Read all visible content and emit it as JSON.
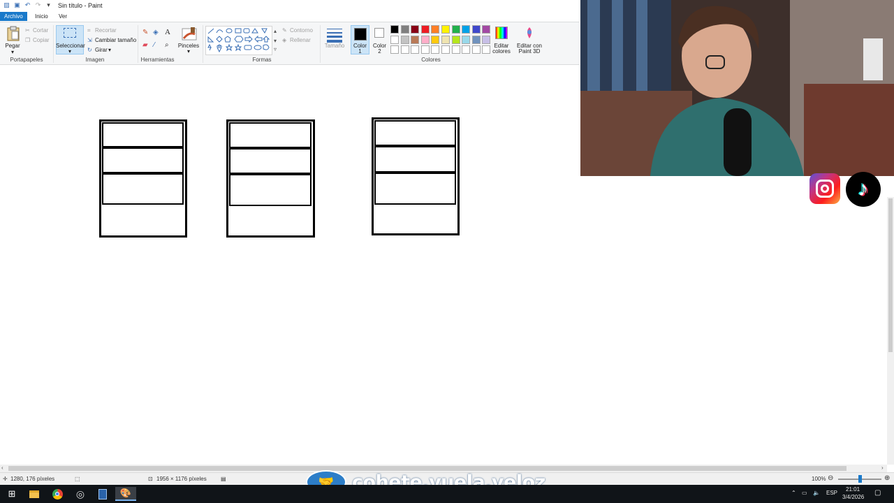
{
  "titlebar": {
    "title": "Sin título - Paint"
  },
  "menu": {
    "file": "Archivo",
    "home": "Inicio",
    "view": "Ver"
  },
  "ribbon": {
    "clipboard": {
      "paste": "Pegar",
      "cut": "Cortar",
      "copy": "Copiar",
      "group": "Portapapeles"
    },
    "image": {
      "select": "Seleccionar",
      "crop": "Recortar",
      "resize": "Cambiar tamaño",
      "rotate": "Girar",
      "group": "Imagen"
    },
    "tools": {
      "group": "Herramientas"
    },
    "brushes": {
      "label": "Pinceles"
    },
    "shapes": {
      "outline": "Contorno",
      "fill": "Rellenar",
      "group": "Formas"
    },
    "size": {
      "label": "Tamaño"
    },
    "color1": {
      "label1": "Color",
      "label2": "1",
      "value": "#000000"
    },
    "color2": {
      "label1": "Color",
      "label2": "2",
      "value": "#ffffff"
    },
    "colors": {
      "group": "Colores",
      "edit1": "Editar",
      "edit2": "colores",
      "paint3d1": "Editar con",
      "paint3d2": "Paint 3D"
    },
    "palette_row1": [
      "#000000",
      "#7f7f7f",
      "#880015",
      "#ed1c24",
      "#ff7f27",
      "#fff200",
      "#22b14c",
      "#00a2e8",
      "#3f48cc",
      "#a349a4"
    ],
    "palette_row2": [
      "#ffffff",
      "#c3c3c3",
      "#b97a57",
      "#ffaec9",
      "#ffc90e",
      "#efe4b0",
      "#b5e61d",
      "#99d9ea",
      "#7092be",
      "#c8bfe7"
    ]
  },
  "status": {
    "cursor": "1280, 176 píxeles",
    "canvas_size": "1956 × 1176 píxeles",
    "zoom": "100%"
  },
  "taskbar": {
    "lang": "ESP",
    "time": "21:01",
    "date": "3/4/2026"
  },
  "overlay": {
    "watermark": "cohete.vuela.veloz"
  }
}
